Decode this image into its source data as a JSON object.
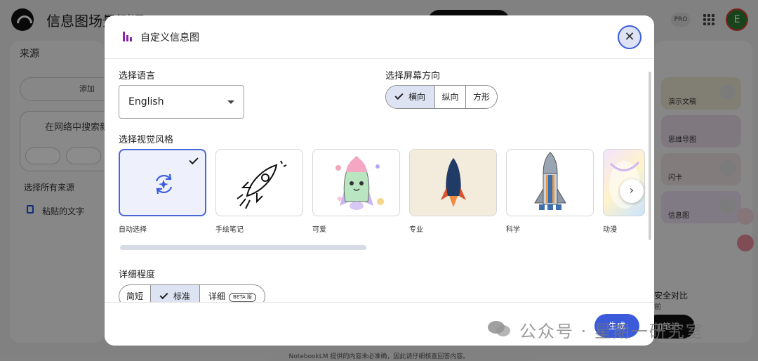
{
  "app": {
    "title": "信息图场景测评",
    "pro_badge": "PRO",
    "avatar_letter": "E",
    "footer_note": "NotebookLM 提供的内容未必准确，因此请仔细核查回答内容。"
  },
  "sources": {
    "title": "来源",
    "add_label": "添加",
    "search_placeholder": "在网络中搜索新来源",
    "select_all": "选择所有来源",
    "items": [
      {
        "label": "粘贴的文字"
      }
    ]
  },
  "studio": {
    "cards": [
      {
        "label": "演示文稿",
        "color": "#ece6d2"
      },
      {
        "label": "思维导图",
        "color": "#eadbe8"
      },
      {
        "label": "闪卡",
        "color": "#efe2e2"
      },
      {
        "label": "信息图",
        "color": "#e8dfee"
      }
    ],
    "note_title": "安全对比",
    "note_time": "前",
    "add_note": "加笔记"
  },
  "dialog": {
    "title": "自定义信息图",
    "close_icon": "close-icon",
    "language": {
      "label": "选择语言",
      "value": "English"
    },
    "orientation": {
      "label": "选择屏幕方向",
      "options": [
        {
          "label": "横向",
          "selected": true
        },
        {
          "label": "纵向",
          "selected": false
        },
        {
          "label": "方形",
          "selected": false
        }
      ]
    },
    "visual_style": {
      "label": "选择视觉风格",
      "options": [
        {
          "label": "自动选择",
          "selected": true,
          "icon": "auto-refresh-icon"
        },
        {
          "label": "手绘笔记",
          "selected": false,
          "icon": "sketch-rocket"
        },
        {
          "label": "可爱",
          "selected": false,
          "icon": "cute-rocket"
        },
        {
          "label": "专业",
          "selected": false,
          "icon": "professional-rocket"
        },
        {
          "label": "科学",
          "selected": false,
          "icon": "scientific-rocket"
        },
        {
          "label": "动漫",
          "selected": false,
          "icon": "anime-art"
        }
      ]
    },
    "detail": {
      "label": "详细程度",
      "options": [
        {
          "label": "简短",
          "selected": false
        },
        {
          "label": "标准",
          "selected": true
        },
        {
          "label": "详细",
          "selected": false,
          "badge": "BETA 版"
        }
      ]
    },
    "generate_label": "生成"
  },
  "watermark": "公众号 · 星期一研究室",
  "colors": {
    "accent": "#3b5bdb",
    "selected_bg": "#dde3f3",
    "infographic_icon": "#8e24aa"
  }
}
